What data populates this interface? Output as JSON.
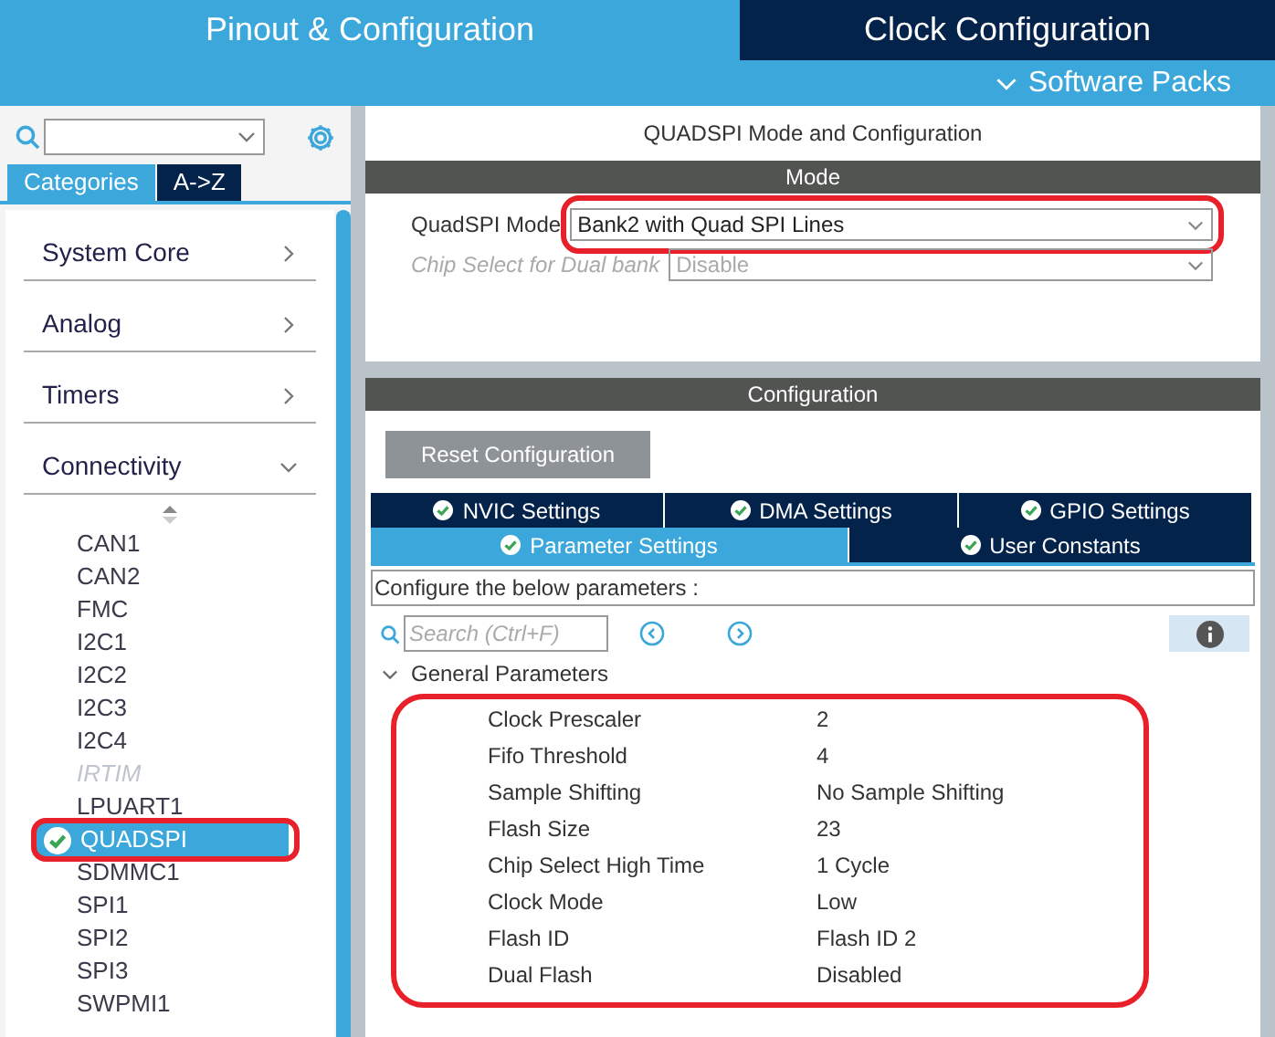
{
  "top_tabs": [
    {
      "label": "Pinout & Configuration",
      "selected": true
    },
    {
      "label": "Clock Configuration",
      "selected": false
    }
  ],
  "software_packs": "Software Packs",
  "sidebar": {
    "view_tabs": [
      {
        "label": "Categories",
        "selected": true
      },
      {
        "label": "A->Z",
        "selected": false
      }
    ],
    "categories": [
      {
        "label": "System Core",
        "expanded": false
      },
      {
        "label": "Analog",
        "expanded": false
      },
      {
        "label": "Timers",
        "expanded": false
      },
      {
        "label": "Connectivity",
        "expanded": true
      }
    ],
    "peripherals": [
      {
        "label": "CAN1",
        "disabled": false,
        "selected": false,
        "enabled": false
      },
      {
        "label": "CAN2",
        "disabled": false,
        "selected": false,
        "enabled": false
      },
      {
        "label": "FMC",
        "disabled": false,
        "selected": false,
        "enabled": false
      },
      {
        "label": "I2C1",
        "disabled": false,
        "selected": false,
        "enabled": false
      },
      {
        "label": "I2C2",
        "disabled": false,
        "selected": false,
        "enabled": false
      },
      {
        "label": "I2C3",
        "disabled": false,
        "selected": false,
        "enabled": false
      },
      {
        "label": "I2C4",
        "disabled": false,
        "selected": false,
        "enabled": false
      },
      {
        "label": "IRTIM",
        "disabled": true,
        "selected": false,
        "enabled": false
      },
      {
        "label": "LPUART1",
        "disabled": false,
        "selected": false,
        "enabled": false
      },
      {
        "label": "QUADSPI",
        "disabled": false,
        "selected": true,
        "enabled": true
      },
      {
        "label": "SDMMC1",
        "disabled": false,
        "selected": false,
        "enabled": false
      },
      {
        "label": "SPI1",
        "disabled": false,
        "selected": false,
        "enabled": false
      },
      {
        "label": "SPI2",
        "disabled": false,
        "selected": false,
        "enabled": false
      },
      {
        "label": "SPI3",
        "disabled": false,
        "selected": false,
        "enabled": false
      },
      {
        "label": "SWPMI1",
        "disabled": false,
        "selected": false,
        "enabled": false
      }
    ]
  },
  "panel_title": "QUADSPI Mode and Configuration",
  "mode": {
    "header": "Mode",
    "fields": [
      {
        "label": "QuadSPI Mode",
        "value": "Bank2 with Quad SPI Lines",
        "disabled": false
      },
      {
        "label": "Chip Select for Dual bank",
        "value": "Disable",
        "disabled": true
      }
    ]
  },
  "configuration": {
    "header": "Configuration",
    "reset_button": "Reset Configuration",
    "tab_rows": [
      [
        {
          "label": "NVIC Settings",
          "selected": false
        },
        {
          "label": "DMA Settings",
          "selected": false
        },
        {
          "label": "GPIO Settings",
          "selected": false
        }
      ],
      [
        {
          "label": "Parameter Settings",
          "selected": true
        },
        {
          "label": "User Constants",
          "selected": false
        }
      ]
    ],
    "hint": "Configure the below parameters :",
    "search": {
      "placeholder": "Search (Ctrl+F)"
    },
    "group": {
      "label": "General Parameters",
      "expanded": true,
      "params": [
        {
          "name": "Clock Prescaler",
          "value": "2"
        },
        {
          "name": "Fifo Threshold",
          "value": "4"
        },
        {
          "name": "Sample Shifting",
          "value": "No Sample Shifting"
        },
        {
          "name": "Flash Size",
          "value": "23"
        },
        {
          "name": "Chip Select High Time",
          "value": "1 Cycle"
        },
        {
          "name": "Clock Mode",
          "value": "Low"
        },
        {
          "name": "Flash ID",
          "value": "Flash ID 2"
        },
        {
          "name": "Dual Flash",
          "value": "Disabled"
        }
      ]
    }
  }
}
